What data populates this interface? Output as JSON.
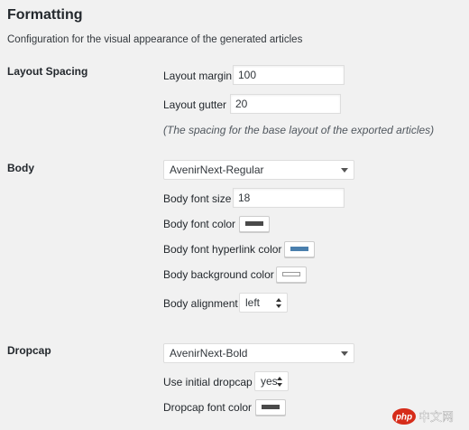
{
  "header": {
    "title": "Formatting",
    "description": "Configuration for the visual appearance of the generated articles"
  },
  "layout_spacing": {
    "label": "Layout Spacing",
    "margin_label": "Layout margin",
    "margin_value": "100",
    "gutter_label": "Layout gutter",
    "gutter_value": "20",
    "hint": "(The spacing for the base layout of the exported articles)"
  },
  "body": {
    "label": "Body",
    "font_select": "AvenirNext-Regular",
    "font_size_label": "Body font size",
    "font_size_value": "18",
    "font_color_label": "Body font color",
    "font_color": "#4a4a4a",
    "hyperlink_color_label": "Body font hyperlink color",
    "hyperlink_color": "#4a7fad",
    "background_color_label": "Body background color",
    "background_color": "#ffffff",
    "alignment_label": "Body alignment",
    "alignment_value": "left"
  },
  "dropcap": {
    "label": "Dropcap",
    "font_select": "AvenirNext-Bold",
    "use_initial_label": "Use initial dropcap",
    "use_initial_value": "yes",
    "font_color_label": "Dropcap font color",
    "font_color": "#4a4a4a"
  },
  "watermark": {
    "text": "php 中文网"
  },
  "colors": {
    "page_bg": "#f1f1f1",
    "watermark_red": "#d62c1a"
  }
}
